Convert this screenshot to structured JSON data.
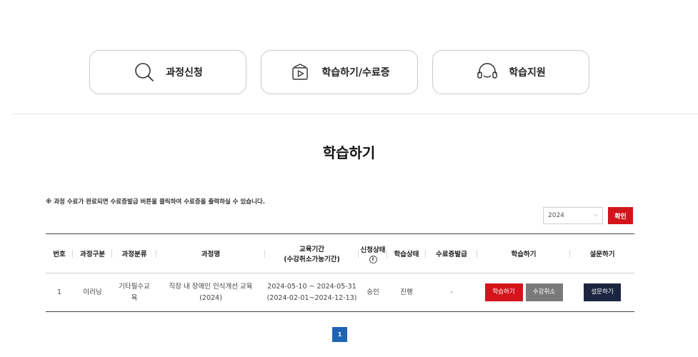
{
  "nav": {
    "apply": {
      "label": "과정신청",
      "icon": "search-icon"
    },
    "study": {
      "label": "학습하기/수료증",
      "icon": "play-video-icon"
    },
    "support": {
      "label": "학습지원",
      "icon": "headset-icon"
    }
  },
  "section_title": "학습하기",
  "notice": "※ 과정 수료가 완료되면 수료증발급 버튼을 클릭하여 수료증을 출력하실 수 있습니다.",
  "filter": {
    "year": "2024",
    "confirm_label": "확인"
  },
  "table": {
    "headers": {
      "no": "번호",
      "type": "과정구분",
      "category": "과정분류",
      "name": "과정명",
      "period_line1": "교육기간",
      "period_line2": "(수강취소가능기간)",
      "apply_status": "신청상태",
      "study_status": "학습상태",
      "certificate": "수료증발급",
      "study": "학습하기",
      "survey": "설문하기"
    },
    "rows": [
      {
        "no": "1",
        "type": "이러닝",
        "category_line1": "기타필수교",
        "category_line2": "육",
        "name_line1": "직장 내 장애인 인식개선 교육",
        "name_line2": "(2024)",
        "period_line1": "2024-05-10 ~ 2024-05-31",
        "period_line2": "(2024-02-01~2024-12-13)",
        "apply_status": "승인",
        "study_status": "진행",
        "certificate": "-",
        "study_btn": "학습하기",
        "cancel_btn": "수강취소",
        "survey_btn": "설문하기"
      }
    ]
  },
  "pagination": {
    "current_page": "1"
  },
  "colors": {
    "accent_red": "#d3141c",
    "gray_button": "#7a7a7a",
    "navy_button": "#1c2540",
    "page_blue": "#1f64b3"
  }
}
